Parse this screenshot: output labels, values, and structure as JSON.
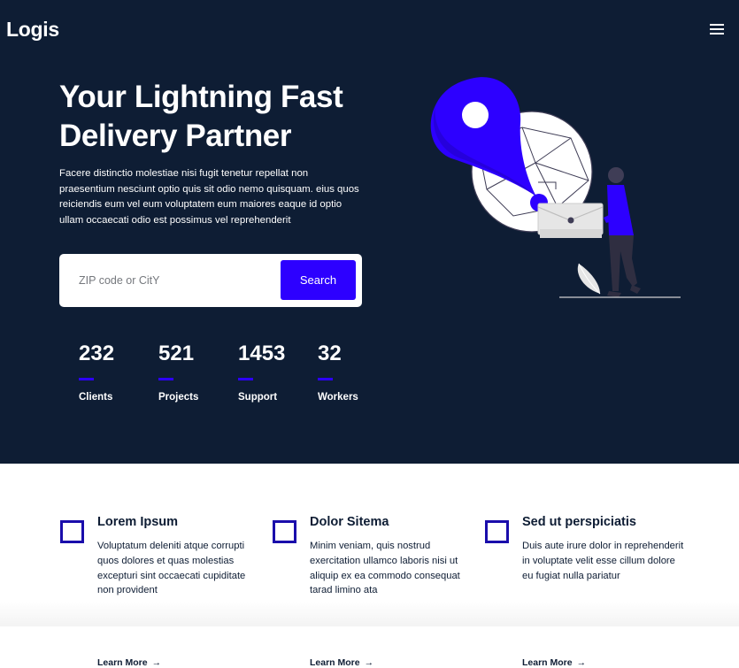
{
  "header": {
    "logo": "Logis",
    "menu_icon": "hamburger-icon"
  },
  "hero": {
    "title": "Your Lightning Fast Delivery Partner",
    "description": "Facere distinctio molestiae nisi fugit tenetur repellat non praesentium nesciunt optio quis sit odio nemo quisquam. eius quos reiciendis eum vel eum voluptatem eum maiores eaque id optio ullam occaecati odio est possimus vel reprehenderit",
    "search": {
      "placeholder": "ZIP code or CitY",
      "value": "",
      "button_label": "Search"
    },
    "stats": [
      {
        "number": "232",
        "label": "Clients"
      },
      {
        "number": "521",
        "label": "Projects"
      },
      {
        "number": "1453",
        "label": "Support"
      },
      {
        "number": "32",
        "label": "Workers"
      }
    ]
  },
  "features": [
    {
      "title": "Lorem Ipsum",
      "text": "Voluptatum deleniti atque corrupti quos dolores et quas molestias excepturi sint occaecati cupiditate non provident",
      "link": "Learn More",
      "icon": "square-outline-icon"
    },
    {
      "title": "Dolor Sitema",
      "text": "Minim veniam, quis nostrud exercitation ullamco laboris nisi ut aliquip ex ea commodo consequat tarad limino ata",
      "link": "Learn More",
      "icon": "square-outline-icon"
    },
    {
      "title": "Sed ut perspiciatis",
      "text": "Duis aute irure dolor in reprehenderit in voluptate velit esse cillum dolore eu fugiat nulla pariatur",
      "link": "Learn More",
      "icon": "square-outline-icon"
    }
  ],
  "colors": {
    "hero_background": "#0e1d34",
    "accent": "#2d00ff",
    "feature_icon": "#1a0dab",
    "text_dark": "#0e1d34"
  }
}
